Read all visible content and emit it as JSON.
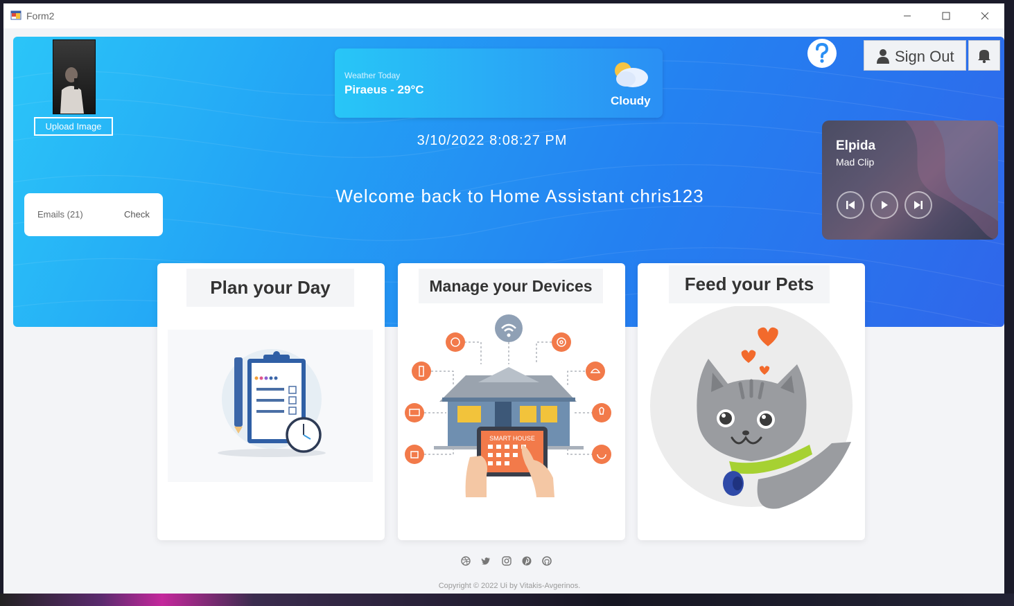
{
  "window": {
    "title": "Form2"
  },
  "profile": {
    "upload_label": "Upload Image"
  },
  "weather": {
    "label": "Weather Today",
    "city_temp": "Piraeus - 29°C",
    "condition": "Cloudy"
  },
  "datetime": "3/10/2022 8:08:27 PM",
  "welcome": "Welcome back to Home Assistant chris123",
  "emails": {
    "label": "Emails (21)",
    "check_label": "Check"
  },
  "header": {
    "help_icon": "question-icon",
    "signout_label": "Sign Out",
    "bell_icon": "bell-icon"
  },
  "music": {
    "song": "Elpida",
    "artist": "Mad Clip",
    "controls": [
      "previous-icon",
      "play-icon",
      "next-icon"
    ]
  },
  "cards": [
    {
      "title": "Plan your Day"
    },
    {
      "title": "Manage your Devices",
      "tablet_label": "SMART HOUSE"
    },
    {
      "title": "Feed your Pets"
    }
  ],
  "social_icons": [
    "dribbble-icon",
    "twitter-icon",
    "instagram-icon",
    "pinterest-icon",
    "github-icon"
  ],
  "copyright": "Copyright © 2022 Ui by Vitakis-Avgerinos.",
  "colors": {
    "accent": "#2a8ff4",
    "hero_start": "#2bc5f8",
    "hero_end": "#2f66ea",
    "orange": "#f27a4a"
  }
}
